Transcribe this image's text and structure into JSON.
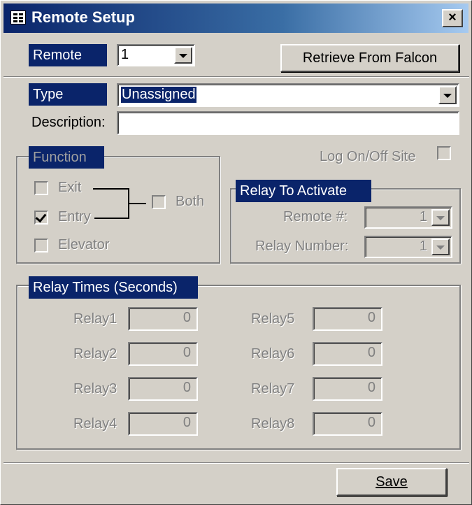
{
  "window": {
    "title": "Remote Setup",
    "close_symbol": "×"
  },
  "remote": {
    "label": "Remote",
    "value": "1",
    "retrieve_button": "Retrieve From Falcon"
  },
  "type": {
    "label": "Type",
    "value": "Unassigned"
  },
  "description": {
    "label": "Description:",
    "value": ""
  },
  "function": {
    "legend": "Function",
    "exit_label": "Exit",
    "exit_checked": false,
    "entry_label": "Entry",
    "entry_checked": true,
    "both_label": "Both",
    "both_checked": false,
    "elevator_label": "Elevator",
    "elevator_checked": false
  },
  "log_on_off": {
    "label": "Log On/Off Site",
    "checked": false
  },
  "relay_to_activate": {
    "legend": "Relay To Activate",
    "remote_label": "Remote #:",
    "remote_value": "1",
    "relay_number_label": "Relay Number:",
    "relay_number_value": "1"
  },
  "relay_times": {
    "legend": "Relay Times (Seconds)",
    "relays": [
      {
        "label": "Relay1",
        "value": "0"
      },
      {
        "label": "Relay2",
        "value": "0"
      },
      {
        "label": "Relay3",
        "value": "0"
      },
      {
        "label": "Relay4",
        "value": "0"
      },
      {
        "label": "Relay5",
        "value": "0"
      },
      {
        "label": "Relay6",
        "value": "0"
      },
      {
        "label": "Relay7",
        "value": "0"
      },
      {
        "label": "Relay8",
        "value": "0"
      }
    ]
  },
  "footer": {
    "save_button": "Save"
  },
  "colors": {
    "title_bar": "#0a246a",
    "label_bg": "#0a246a",
    "face": "#d4d0c8"
  }
}
